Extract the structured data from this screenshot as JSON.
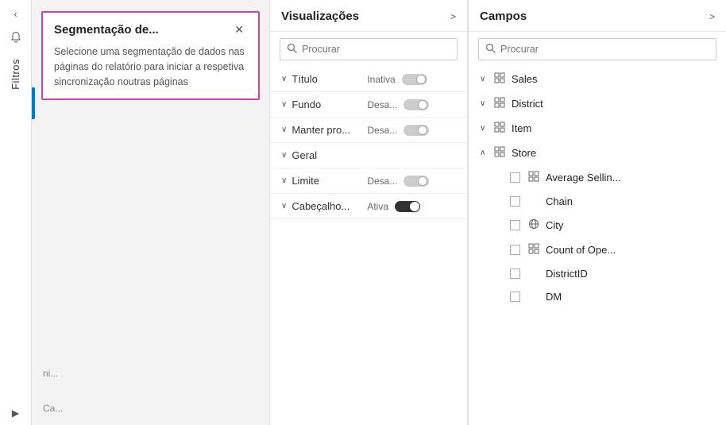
{
  "leftBar": {
    "arrow": "‹",
    "icon": "🔔",
    "label": "Filtros",
    "play_arrow": "▶"
  },
  "segmentacao": {
    "title": "Segmentação de...",
    "close": "✕",
    "description": "Selecione uma segmentação de dados nas páginas do relatório para iniciar a respetiva sincronização noutras páginas"
  },
  "bottomLeftLabels": {
    "label1": "ni...",
    "label2": "Ca..."
  },
  "visualizacoes": {
    "title": "Visualizações",
    "arrow": ">",
    "search_placeholder": "Procurar",
    "items": [
      {
        "name": "Título",
        "status": "Inativa",
        "toggle": "off"
      },
      {
        "name": "Fundo",
        "status": "Desa...",
        "toggle": "off"
      },
      {
        "name": "Manter pro...",
        "status": "Desa...",
        "toggle": "off"
      },
      {
        "name": "Geral",
        "status": "",
        "toggle": null
      },
      {
        "name": "Limite",
        "status": "Desa...",
        "toggle": "off"
      },
      {
        "name": "Cabeçalho...",
        "status": "Ativa",
        "toggle": "on"
      }
    ]
  },
  "campos": {
    "title": "Campos",
    "arrow": ">",
    "search_placeholder": "Procurar",
    "items": [
      {
        "type": "group",
        "name": "Sales",
        "icon": "grid",
        "expanded": true,
        "indent": false
      },
      {
        "type": "group",
        "name": "District",
        "icon": "grid",
        "expanded": true,
        "indent": false
      },
      {
        "type": "group",
        "name": "Item",
        "icon": "grid",
        "expanded": true,
        "indent": false
      },
      {
        "type": "group",
        "name": "Store",
        "icon": "grid",
        "expanded": false,
        "indent": false
      },
      {
        "type": "item",
        "name": "Average Sellin...",
        "icon": "grid",
        "indent": true,
        "checked": false
      },
      {
        "type": "item",
        "name": "Chain",
        "icon": "none",
        "indent": true,
        "checked": false
      },
      {
        "type": "item",
        "name": "City",
        "icon": "globe",
        "indent": true,
        "checked": false
      },
      {
        "type": "item",
        "name": "Count of Ope...",
        "icon": "grid",
        "indent": true,
        "checked": false
      },
      {
        "type": "item",
        "name": "DistrictID",
        "icon": "none",
        "indent": true,
        "checked": false
      },
      {
        "type": "item",
        "name": "DM",
        "icon": "none",
        "indent": true,
        "checked": false
      }
    ]
  }
}
